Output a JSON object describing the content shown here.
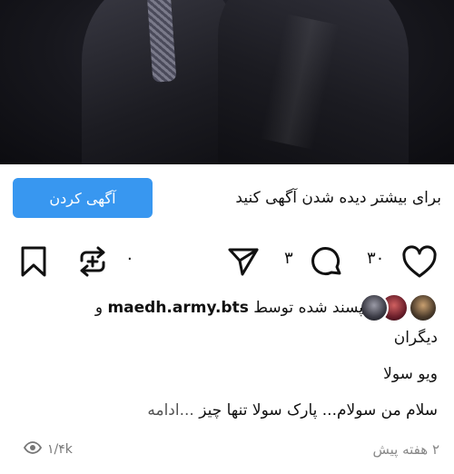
{
  "promo": {
    "text": "برای بیشتر دیده شدن آگهی کنید",
    "button_label": "آگهی کردن"
  },
  "actions": {
    "likes_count": "۳۰",
    "comments_count": "۳",
    "reposts_count": "۰"
  },
  "likes_summary": {
    "prefix": "پسند شده توسط",
    "username": "maedh.army.bts",
    "suffix": "و",
    "others": "دیگران"
  },
  "caption": {
    "title": "ویو سولا",
    "body": "سلام من سولام... پارک سولا تنها چیز",
    "more": "...ادامه"
  },
  "footer": {
    "views": "۱/۴k",
    "time_ago": "۲ هفته پیش"
  },
  "colors": {
    "accent": "#3897f0",
    "text": "#111111",
    "muted": "#888888"
  },
  "icons": [
    "heart-icon",
    "comment-icon",
    "send-icon",
    "repost-icon",
    "bookmark-icon",
    "eye-icon"
  ]
}
